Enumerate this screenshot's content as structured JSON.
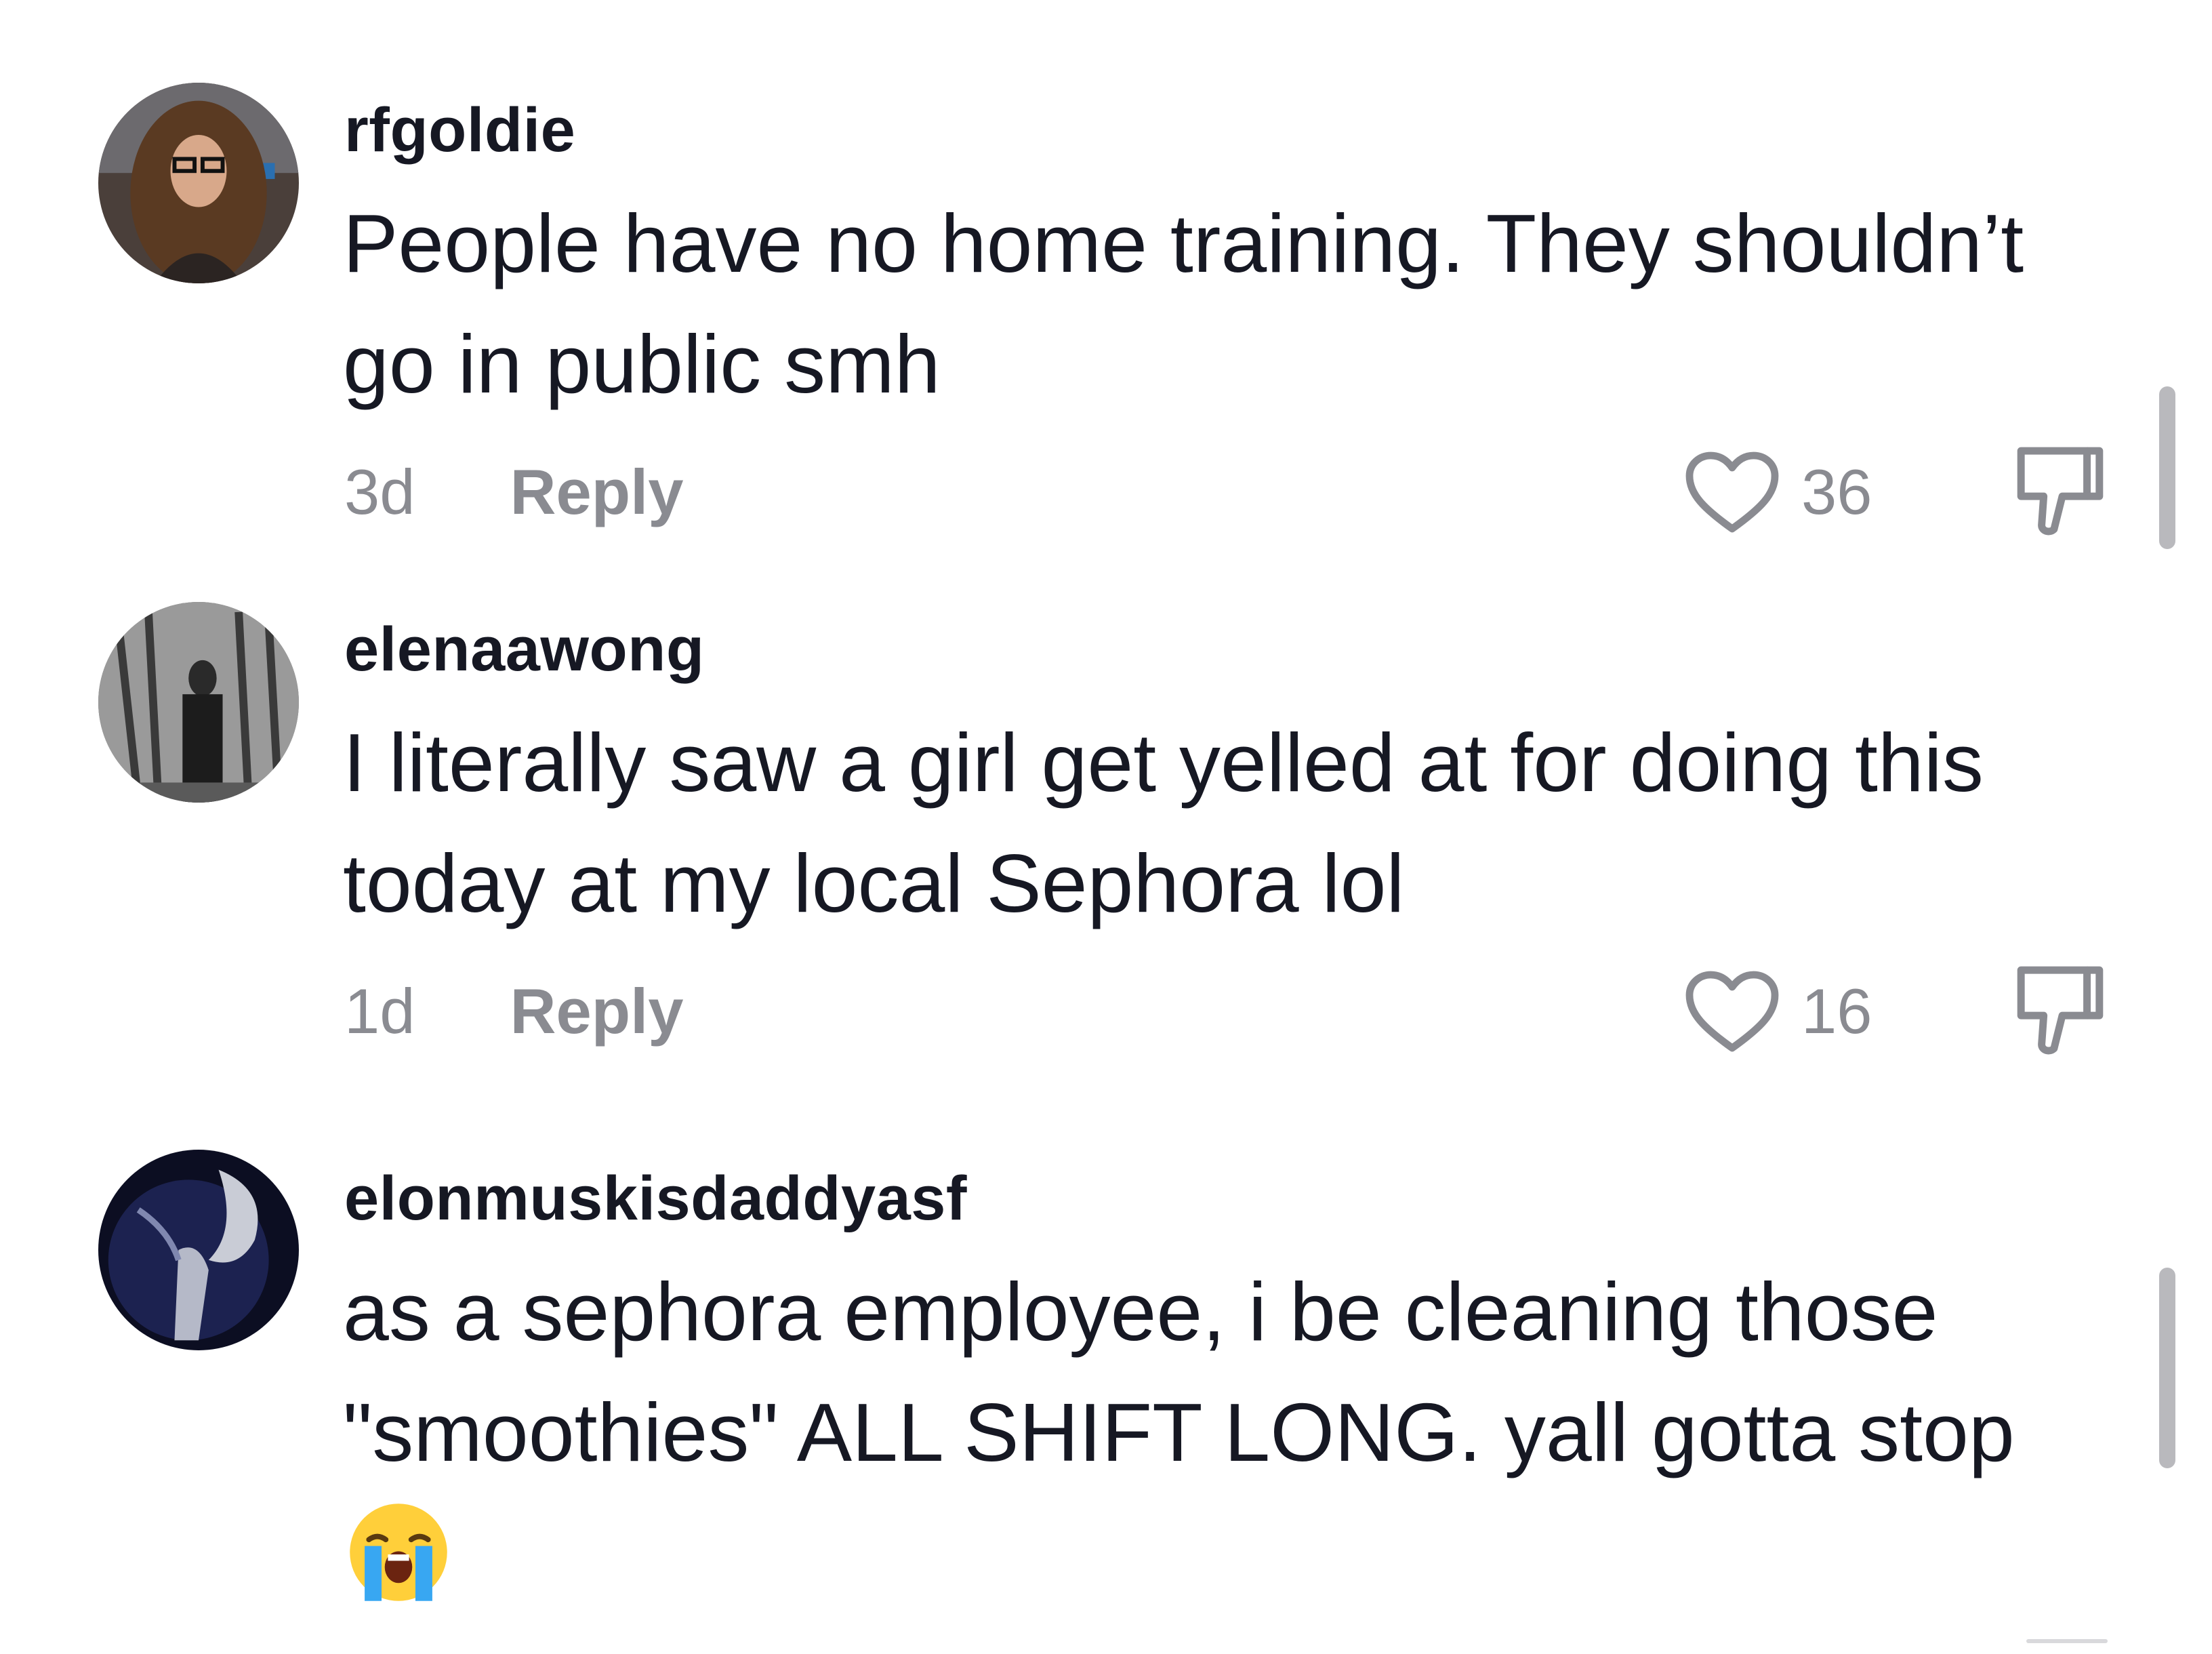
{
  "comments": [
    {
      "username": "rfgoldie",
      "text": "People have no home training. They shouldn’t\ngo in public smh",
      "age": "3d",
      "reply_label": "Reply",
      "likes": "36"
    },
    {
      "username": "elenaawong",
      "text": "I literally saw a girl get yelled at for doing this\ntoday at my local Sephora lol",
      "age": "1d",
      "reply_label": "Reply",
      "likes": "16"
    },
    {
      "username": "elonmuskisdaddyasf",
      "text": "as a sephora employee, i be cleaning those\n\"smoothies\" ALL SHIFT LONG. yall gotta stop",
      "emoji": "loudly-crying-face-emoji"
    }
  ],
  "colors": {
    "text_primary": "#161823",
    "text_secondary": "#8a8b91",
    "scrollbar": "#b9b9bd"
  },
  "icons": [
    "heart-icon",
    "dislike-icon",
    "loudly-crying-face-emoji"
  ]
}
